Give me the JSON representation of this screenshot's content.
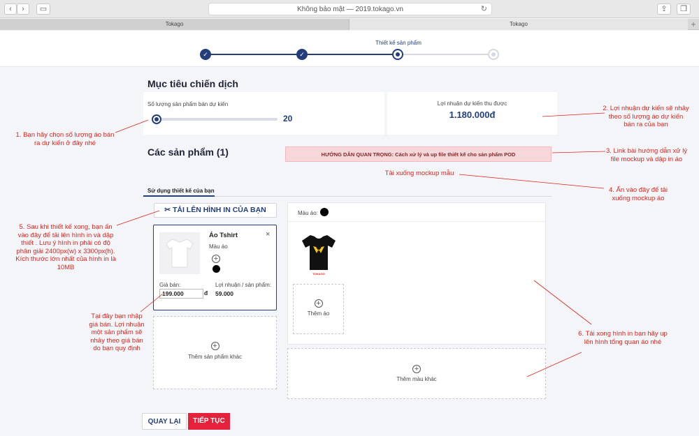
{
  "browser": {
    "address": "Không bảo mật — 2019.tokago.vn",
    "tabs": [
      "Tokago",
      "Tokago"
    ],
    "new_tab": "+"
  },
  "stepper": {
    "current_label": "Thiết kế sản phẩm",
    "check": "✓"
  },
  "campaign": {
    "title": "Mục tiêu chiến dịch",
    "quantity_label": "Số lượng sản phẩm bán dự kiến",
    "quantity_value": "20",
    "slider_fraction": 0.0,
    "profit_label": "Lợi nhuận dự kiến thu được",
    "profit_value": "1.180.000đ"
  },
  "products": {
    "title": "Các sản phẩm (1)",
    "guide_banner": "HƯỚNG DẪN QUAN TRỌNG: Cách xử lý và up file thiết kế cho sản phẩm POD",
    "download_mockup": "Tải xuống mockup mẫu",
    "tab_label": "Sử dụng thiết kế của bạn",
    "upload_button": "TẢI LÊN HÌNH IN CỦA BẠN",
    "item": {
      "name": "Áo Tshirt",
      "color_label": "Màu áo",
      "close": "×",
      "price_label": "Giá bán:",
      "price_value": "199.000",
      "currency": "đ",
      "profit_label": "Lợi nhuận / sản phẩm:",
      "profit_value": "59.000"
    },
    "add_other_product": "Thêm sản phẩm khác",
    "mockup": {
      "color_label": "Màu áo:",
      "add_shirt": "Thêm áo",
      "add_color": "Thêm màu khác",
      "shirt_brand": "TOKAGO"
    }
  },
  "actions": {
    "back": "QUAY LẠI",
    "next": "TIẾP TỤC"
  },
  "annotations": {
    "a1": "1. Bạn hãy chọn số lượng áo bán ra dự kiến ở đây nhé",
    "a2": "2. Lợi nhuận dự kiến sẽ nhảy theo số lượng áo dự kiến bán ra của bạn",
    "a3": "3. Link bài hướng dẫn xử lý file mockup và dập in áo",
    "a4": "4. Ấn vào đây để tải xuống mockup áo",
    "a5": "5. Sau khi thiết kế xong, bạn ấn vào đây để tải lên hình in và dập thiết . Lưu ý hình in phải có độ phân giải 2400px(w) x 3300px(h). Kích thước lớn nhất của hình in là 10MB",
    "a6": "6. Tải xong hình in bạn hãy up lên hình tổng quan áo nhé",
    "a7": "Tại đây bạn nhập giá bán. Lợi nhuận một sản phẩm sẽ nhảy theo giá bán do bạn quy định"
  },
  "colors": {
    "navy": "#243e7c",
    "annotation_red": "#e2231a",
    "next_button": "#e5213b",
    "banner_bg": "#f8d7da"
  }
}
